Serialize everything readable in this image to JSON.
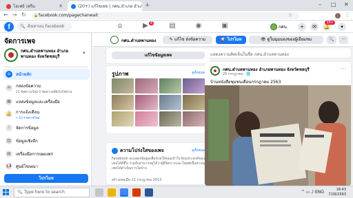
{
  "browser": {
    "tabs": [
      {
        "title": "โอเฟย์ เฟรีม",
        "active": false
      },
      {
        "title": "(20+) แก้ไขเพจ | กศน.อำเภอ อำเภอเพ",
        "active": true
      }
    ],
    "new_tab": "+",
    "url": "facebook.com/pagechanwait",
    "window_controls": {
      "minimize": "–",
      "maximize": "□",
      "close": "✕"
    }
  },
  "fb_header": {
    "logo": "f",
    "search_placeholder": "ค้นหาบน Facebook",
    "nav_badge": "4",
    "profile_name": "กศน.",
    "round_badge": "20+"
  },
  "sidebar": {
    "title": "จัดการเพจ",
    "page_name": "กศน.ตำบลพานทอง อำเภอพานทอง จังหวัดชลบุรี",
    "more": "▾",
    "items": [
      {
        "label": "หน้าหลัก",
        "sub": "",
        "active": true
      },
      {
        "label": "กล่องข้อความ",
        "sub": "21 ข้อความใหม่ 0 ข้อความที่ยังไม่ได้อ่าน",
        "active": false
      },
      {
        "label": "แหล่งข้อมูลและเครื่องมือ",
        "sub": "",
        "active": false
      },
      {
        "label": "การแจ้งเตือน",
        "sub": "• 10 รายการใหม่",
        "active": false
      },
      {
        "label": "ข้อมูลเชิงลึก",
        "sub": "",
        "active": false
      },
      {
        "label": "เครื่องมือการเผยแพร่",
        "sub": "",
        "active": false
      },
      {
        "label": "ศูนย์โฆษณา",
        "sub": "",
        "active": false
      }
    ],
    "extra_item": "จัดการข้อมูล",
    "promote": "โปรโมท"
  },
  "pagebar": {
    "page_name": "กศน.ตำบลพานทอง",
    "edit": "✎ แก้ไข ส่งข้อความ",
    "promote": "📢 โปรโมท",
    "view_as": "👁 ดูในมุมมองของผู้เยี่ยมชม",
    "search": "🔍",
    "more": "···"
  },
  "center": {
    "edit_page_info": "แก้ไขข้อมูลเพจ",
    "photos_title": "รูปภาพ",
    "photos_link": "ดูทั้งหมด",
    "transparency_title": "ความโปร่งใสของเพจ",
    "transparency_link": "ดูทั้งหมด",
    "transparency_body": "Facebook จะแสดงข้อมูลเพื่อช่วยให้คุณเข้าใจวัตถุประสงค์ของเพจได้ดีขึ้น ร่วมถึงสามารถดูได้ว่าผู้ที่จัดการและโพสต์เนื้อหาบนเพจได้ดำเนินการใดบ้าง",
    "transparency_foot": "สร้างเพจเมื่อ 11 กรกฎาคม 2013"
  },
  "post1": {
    "text": "แสดงความคิดเห็นในชื่อ กศน.ตำบลพานทอง"
  },
  "post2": {
    "name": "กศน.ตำบลพานทอง อำเภอพานทอง จังหวัดชลบุรี",
    "date": "25 กรกฎาคม · 🌐",
    "text": "บ้านหนังสือชุมชนเดือนกรกฎาคม 2563",
    "more": "···"
  },
  "taskbar": {
    "search_placeholder": "Type here to search",
    "time": "18:43",
    "date": "7/29/2563",
    "sys": "^ ▭ ♪ ENG"
  },
  "colors": {
    "fb_blue": "#1877f2",
    "active_bg": "#e7f3ff"
  }
}
